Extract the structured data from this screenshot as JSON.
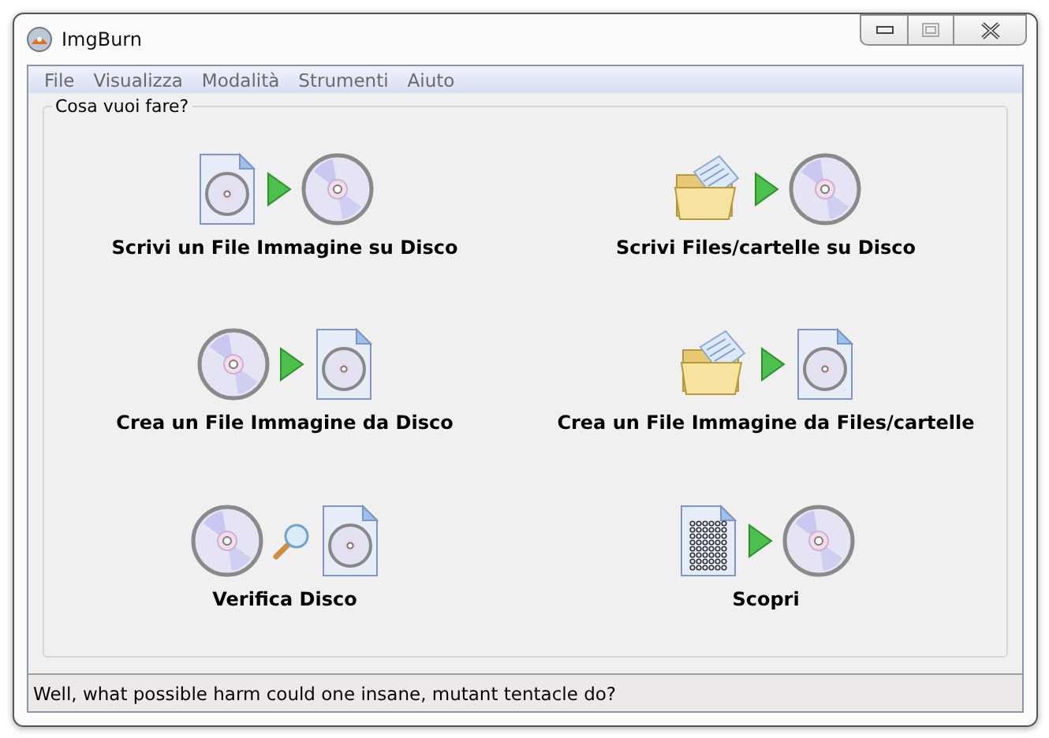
{
  "window": {
    "title": "ImgBurn"
  },
  "menu": [
    "File",
    "Visualizza",
    "Modalità",
    "Strumenti",
    "Aiuto"
  ],
  "group": {
    "title": "Cosa vuoi fare?"
  },
  "actions": [
    {
      "label": "Scrivi un File Immagine su Disco",
      "icons": [
        {
          "kind": "image-file"
        },
        {
          "kind": "arrow"
        },
        {
          "kind": "disc"
        }
      ]
    },
    {
      "label": "Scrivi Files/cartelle su Disco",
      "icons": [
        {
          "kind": "folder"
        },
        {
          "kind": "arrow"
        },
        {
          "kind": "disc"
        }
      ]
    },
    {
      "label": "Crea un File Immagine da Disco",
      "icons": [
        {
          "kind": "disc"
        },
        {
          "kind": "arrow"
        },
        {
          "kind": "image-file"
        }
      ]
    },
    {
      "label": "Crea un File Immagine da Files/cartelle",
      "icons": [
        {
          "kind": "folder"
        },
        {
          "kind": "arrow"
        },
        {
          "kind": "image-file"
        }
      ]
    },
    {
      "label": "Verifica Disco",
      "icons": [
        {
          "kind": "disc"
        },
        {
          "kind": "magnifier"
        },
        {
          "kind": "image-file"
        }
      ]
    },
    {
      "label": "Scopri",
      "icons": [
        {
          "kind": "data-file"
        },
        {
          "kind": "arrow"
        },
        {
          "kind": "disc"
        }
      ]
    }
  ],
  "status_bar": {
    "text": "Well, what possible harm could one insane, mutant tentacle do?"
  }
}
